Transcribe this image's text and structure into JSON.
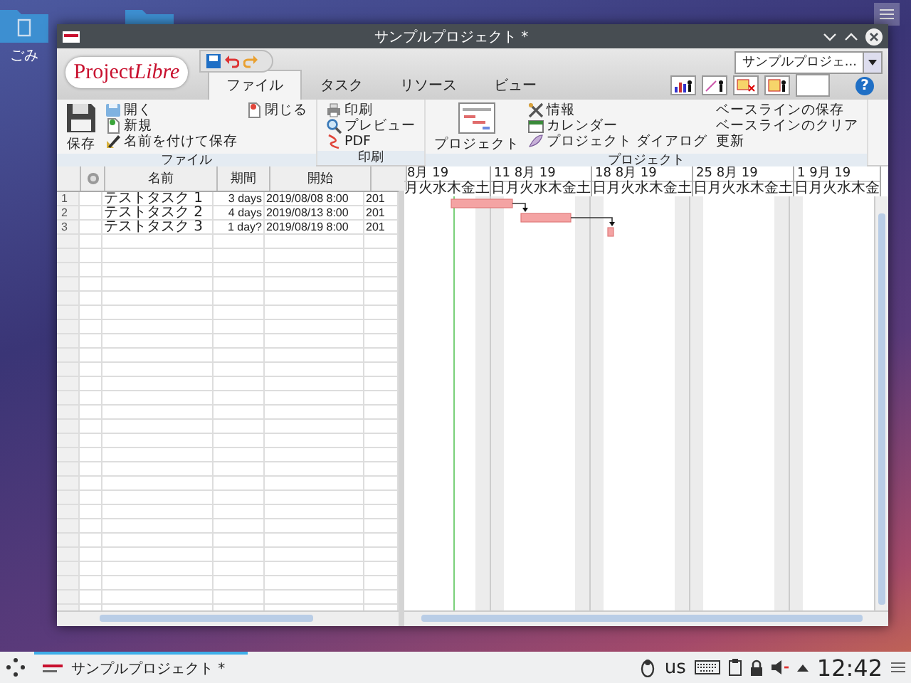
{
  "desktop": {
    "trash_label": "ごみ"
  },
  "window": {
    "title": "サンプルプロジェクト *"
  },
  "logo": {
    "part_1": "Project",
    "part_2": "Libre"
  },
  "tabs": [
    {
      "label": "ファイル",
      "selected": true
    },
    {
      "label": "タスク",
      "selected": false
    },
    {
      "label": "リソース",
      "selected": false
    },
    {
      "label": "ビュー",
      "selected": false
    }
  ],
  "project_selector": {
    "value": "サンプルプロジェ..."
  },
  "help": "?",
  "ribbon": {
    "groups": [
      {
        "label": "ファイル",
        "large": "保存",
        "columns": [
          [
            "開く",
            "新規",
            "名前を付けて保存"
          ],
          [
            "閉じる"
          ]
        ]
      },
      {
        "label": "印刷",
        "columns": [
          [
            "印刷",
            "プレビュー",
            "PDF"
          ]
        ]
      },
      {
        "label": "プロジェクト",
        "large": "プロジェクト",
        "columns": [
          [
            "情報",
            "カレンダー",
            "プロジェクト ダイアログ"
          ],
          [
            "ベースラインの保存",
            "ベースラインのクリア",
            "更新"
          ]
        ]
      }
    ]
  },
  "table": {
    "columns": [
      "名前",
      "期間",
      "開始"
    ],
    "rows": [
      {
        "number": "1",
        "name": "テストタスク 1",
        "duration": "3 days",
        "start": "2019/08/08 8:00",
        "column_6": "201"
      },
      {
        "number": "2",
        "name": "テストタスク 2",
        "duration": "4 days",
        "start": "2019/08/13 8:00",
        "column_6": "201"
      },
      {
        "number": "3",
        "name": "テストタスク 3",
        "duration": "1 day?",
        "start": "2019/08/19 8:00",
        "column_6": "201"
      }
    ]
  },
  "gantt": {
    "weeks": [
      {
        "label": "8月 19",
        "days": [
          "月",
          "火",
          "水",
          "木",
          "金",
          "土"
        ]
      },
      {
        "label": "11 8月 19",
        "days": [
          "日",
          "月",
          "火",
          "水",
          "木",
          "金",
          "土"
        ]
      },
      {
        "label": "18 8月 19",
        "days": [
          "日",
          "月",
          "火",
          "水",
          "木",
          "金",
          "土"
        ]
      },
      {
        "label": "25 8月 19",
        "days": [
          "日",
          "月",
          "火",
          "水",
          "木",
          "金",
          "土"
        ]
      },
      {
        "label": "1 9月 19",
        "days": [
          "日",
          "月",
          "火",
          "水",
          "木",
          "金"
        ]
      }
    ]
  },
  "taskbar": {
    "task": "サンプルプロジェクト *",
    "keyboard": "us",
    "clock": "12:42"
  }
}
